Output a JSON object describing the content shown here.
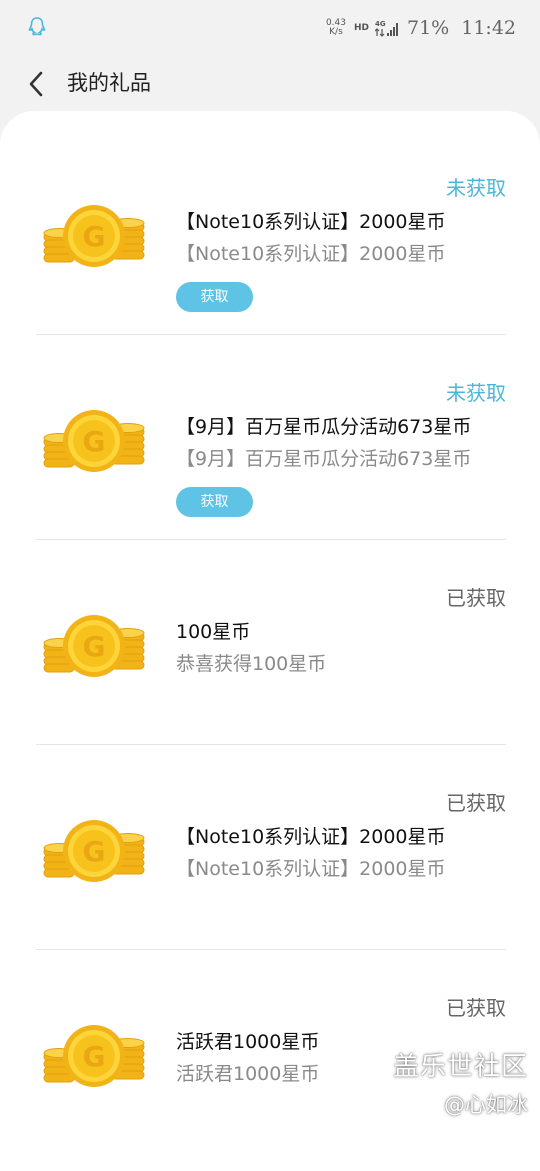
{
  "status_bar": {
    "speed_value": "0.43",
    "speed_unit": "K/s",
    "hd": "HD",
    "network": "4G",
    "battery": "71%",
    "time": "11:42"
  },
  "header": {
    "title": "我的礼品"
  },
  "gifts": [
    {
      "status": "未获取",
      "title": "【Note10系列认证】2000星币",
      "description": "【Note10系列认证】2000星币",
      "button": "获取"
    },
    {
      "status": "未获取",
      "title": "【9月】百万星币瓜分活动673星币",
      "description": "【9月】百万星币瓜分活动673星币",
      "button": "获取"
    },
    {
      "status": "已获取",
      "title": "100星币",
      "description": "恭喜获得100星币"
    },
    {
      "status": "已获取",
      "title": "【Note10系列认证】2000星币",
      "description": "【Note10系列认证】2000星币"
    },
    {
      "status": "已获取",
      "title": "活跃君1000星币",
      "description": "活跃君1000星币"
    }
  ],
  "watermark": {
    "line1": "盖乐世社区",
    "line2": "@心如冰"
  },
  "colors": {
    "accent": "#4bb7d8",
    "button": "#5ec3e5",
    "coin": "#f7c21b"
  }
}
